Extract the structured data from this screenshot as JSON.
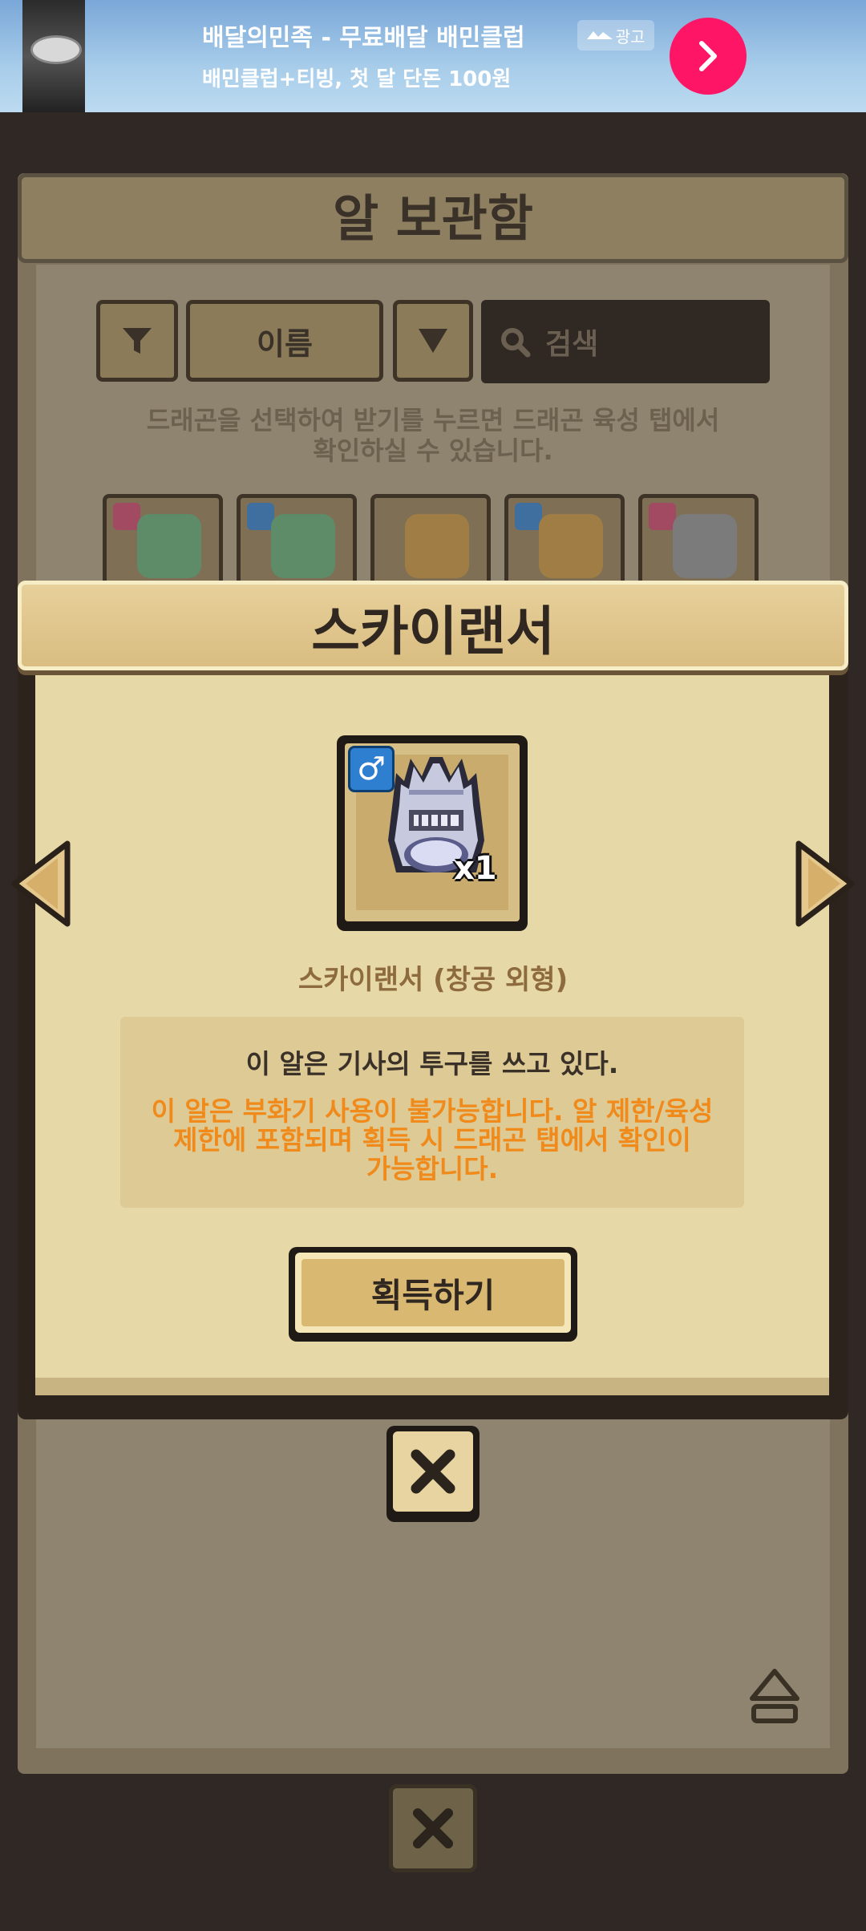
{
  "ad": {
    "title": "배달의민족 - 무료배달 배민클럽",
    "subtitle": "배민클럽+티빙, 첫 달 단돈 100원",
    "badge": "광고"
  },
  "background": {
    "title": "알 보관함",
    "sort_label": "이름",
    "search_placeholder": "검색",
    "info_line1": "드래곤을 선택하여 받기를 누르면 드래곤 육성 탭에서",
    "info_line2": "확인하실 수 있습니다.",
    "slots": [
      {
        "gender": "female",
        "color": "#6aa37a"
      },
      {
        "gender": "male",
        "color": "#6aa37a"
      },
      {
        "gender": "none",
        "color": "#c79a4e"
      },
      {
        "gender": "male",
        "color": "#c79a4e"
      },
      {
        "gender": "female",
        "color": "#8e8e8e"
      }
    ]
  },
  "modal": {
    "title": "스카이랜서",
    "egg_quantity": "x1",
    "egg_gender_symbol": "♂",
    "egg_name": "스카이랜서 (창공 외형)",
    "description": "이 알은 기사의 투구를 쓰고 있다.",
    "warning_line1": "이 알은 부화기 사용이 불가능합니다. 알 제한/육성",
    "warning_line2": "제한에 포함되며 획득 시 드래곤 탭에서 확인이",
    "warning_line3": "가능합니다.",
    "acquire_button": "획득하기"
  },
  "colors": {
    "warning": "#f08a1a",
    "male_badge": "#2f7fd1",
    "female_badge": "#c3486f",
    "ad_button": "#ff1565"
  }
}
